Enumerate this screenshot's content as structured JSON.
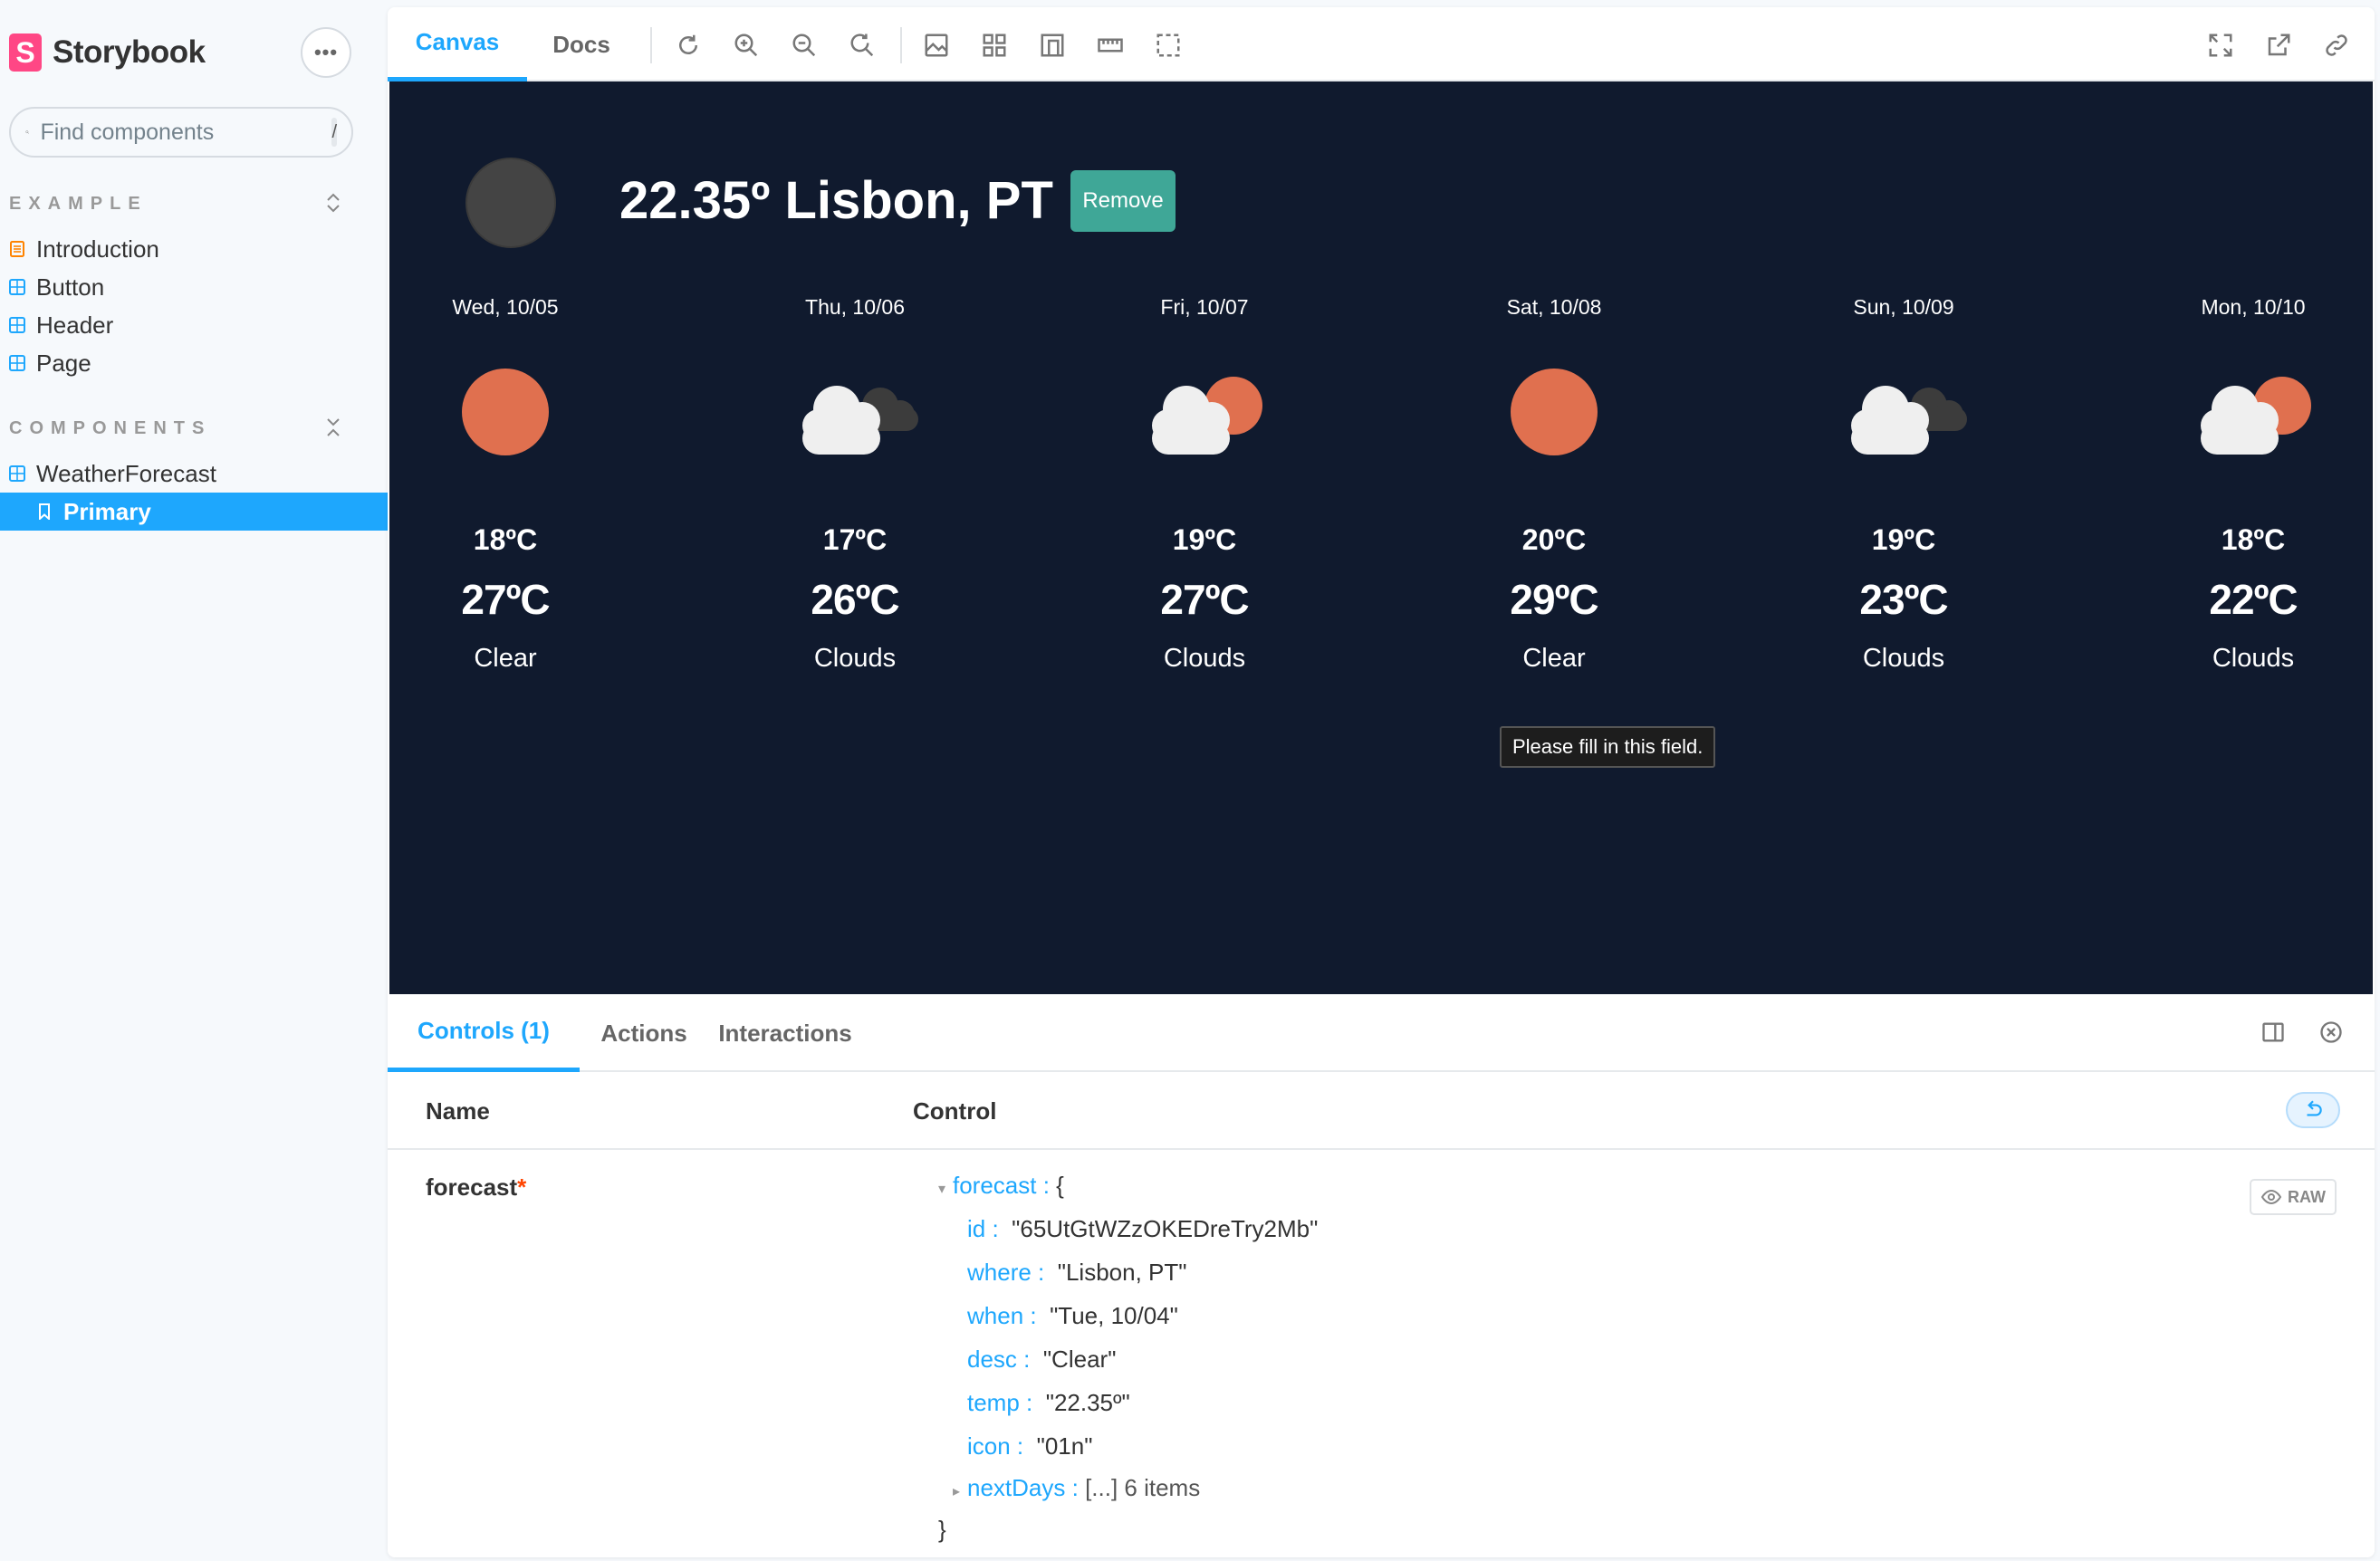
{
  "sidebar": {
    "brand": "Storybook",
    "search_placeholder": "Find components",
    "search_shortcut": "/",
    "sections": [
      {
        "title": "EXAMPLE",
        "items": [
          "Introduction",
          "Button",
          "Header",
          "Page"
        ]
      },
      {
        "title": "COMPONENTS",
        "items": [
          "WeatherForecast"
        ],
        "selected": "Primary"
      }
    ]
  },
  "toolbar": {
    "tabs": [
      "Canvas",
      "Docs"
    ],
    "active_tab": "Canvas"
  },
  "canvas": {
    "current": {
      "title": "22.35º Lisbon, PT",
      "remove_label": "Remove"
    },
    "days": [
      {
        "date": "Wed, 10/05",
        "icon": "sun-icon",
        "min": "18ºC",
        "max": "27ºC",
        "desc": "Clear"
      },
      {
        "date": "Thu, 10/06",
        "icon": "dark-clouds-icon",
        "min": "17ºC",
        "max": "26ºC",
        "desc": "Clouds"
      },
      {
        "date": "Fri, 10/07",
        "icon": "sun-cloud-icon",
        "min": "19ºC",
        "max": "27ºC",
        "desc": "Clouds"
      },
      {
        "date": "Sat, 10/08",
        "icon": "sun-icon",
        "min": "20ºC",
        "max": "29ºC",
        "desc": "Clear"
      },
      {
        "date": "Sun, 10/09",
        "icon": "dark-clouds-icon",
        "min": "19ºC",
        "max": "23ºC",
        "desc": "Clouds"
      },
      {
        "date": "Mon, 10/10",
        "icon": "sun-cloud-icon",
        "min": "18ºC",
        "max": "22ºC",
        "desc": "Clouds"
      }
    ],
    "tooltip": "Please fill in this field."
  },
  "addons": {
    "tabs": [
      "Controls (1)",
      "Actions",
      "Interactions"
    ],
    "active_tab": "Controls (1)",
    "headers": {
      "name": "Name",
      "control": "Control"
    },
    "row": {
      "name": "forecast",
      "required_mark": "*",
      "raw_label": "RAW",
      "json_key": "forecast",
      "fields": [
        {
          "key": "id",
          "value": "\"65UtGtWZzOKEDreTry2Mb\""
        },
        {
          "key": "where",
          "value": "\"Lisbon, PT\""
        },
        {
          "key": "when",
          "value": "\"Tue, 10/04\""
        },
        {
          "key": "desc",
          "value": "\"Clear\""
        },
        {
          "key": "temp",
          "value": "\"22.35º\""
        },
        {
          "key": "icon",
          "value": "\"01n\""
        }
      ],
      "collapsed": {
        "key": "nextDays",
        "value": "[...] 6 items"
      }
    }
  },
  "colors": {
    "accent": "#1ea7fd",
    "canvas_bg": "#101a2e",
    "sun": "#e0704f",
    "remove_button": "#3fa797"
  }
}
